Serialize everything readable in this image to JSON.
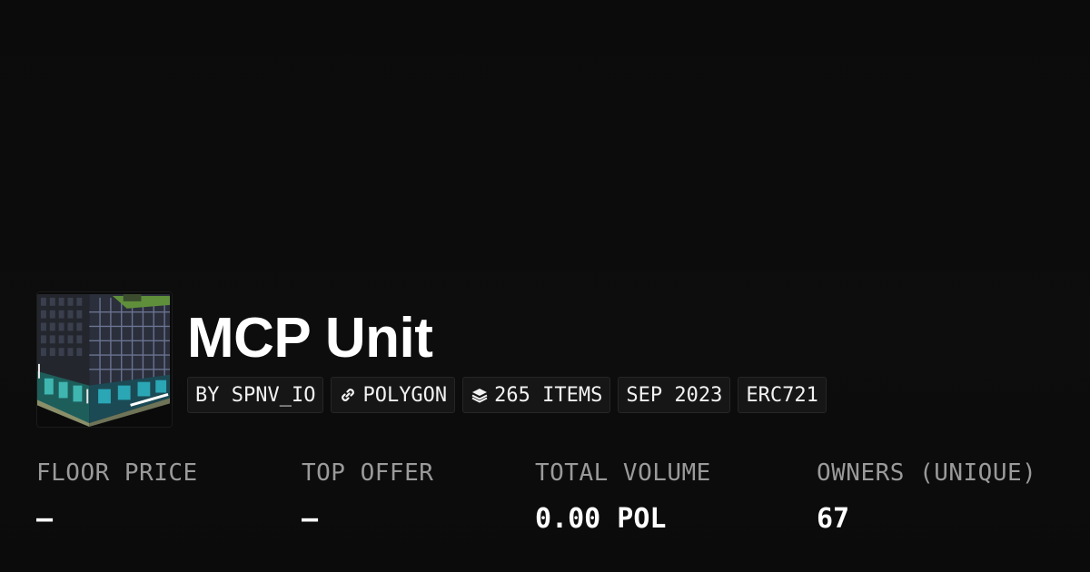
{
  "collection": {
    "title": "MCP Unit",
    "image_alt": "MCP Unit collection image"
  },
  "tags": [
    {
      "label": "BY SPNV_IO",
      "icon": null
    },
    {
      "label": "POLYGON",
      "icon": "link-icon"
    },
    {
      "label": "265 ITEMS",
      "icon": "layers-icon"
    },
    {
      "label": "SEP 2023",
      "icon": null
    },
    {
      "label": "ERC721",
      "icon": null
    }
  ],
  "stats": [
    {
      "label": "FLOOR PRICE",
      "value": "–"
    },
    {
      "label": "TOP OFFER",
      "value": "–"
    },
    {
      "label": "TOTAL VOLUME",
      "value": "0.00 POL"
    },
    {
      "label": "OWNERS (UNIQUE)",
      "value": "67"
    }
  ],
  "colors": {
    "background": "#0b0b0b",
    "tag_background": "#161616",
    "label_gray": "#9a9a9a",
    "text_white": "#ffffff"
  }
}
